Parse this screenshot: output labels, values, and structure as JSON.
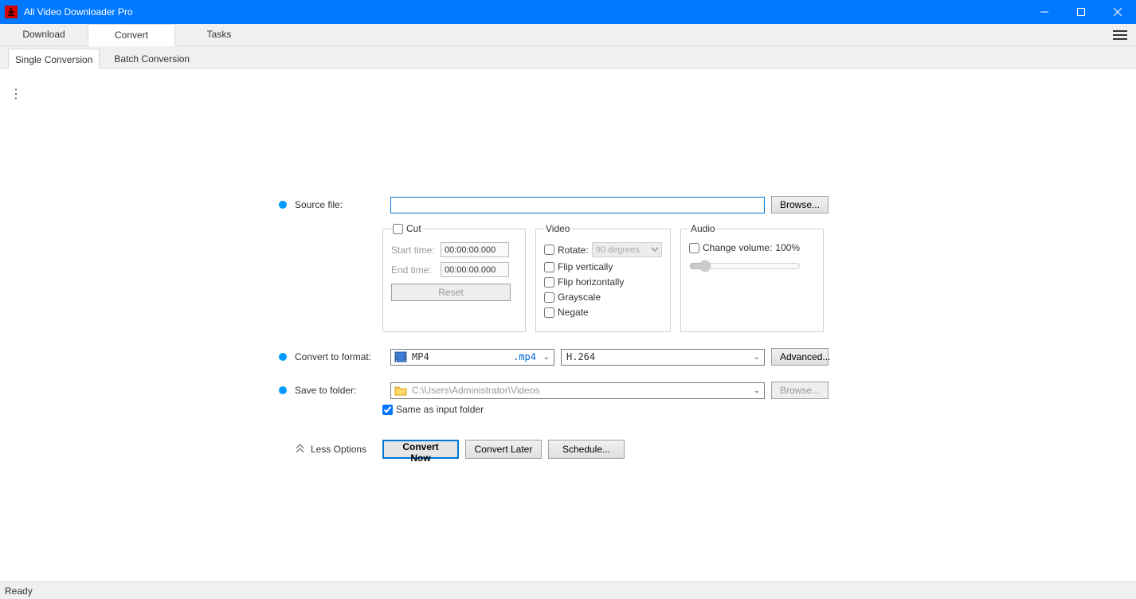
{
  "window": {
    "title": "All Video Downloader Pro"
  },
  "main_tabs": [
    "Download",
    "Convert",
    "Tasks"
  ],
  "main_tab_active": 1,
  "sub_tabs": [
    "Single Conversion",
    "Batch Conversion"
  ],
  "sub_tab_active": 0,
  "form": {
    "source_label": "Source file:",
    "source_value": "",
    "browse_label": "Browse...",
    "cut": {
      "legend": "Cut",
      "start_label": "Start time:",
      "start_value": "00:00:00.000",
      "end_label": "End time:",
      "end_value": "00:00:00.000",
      "reset_label": "Reset"
    },
    "video": {
      "legend": "Video",
      "rotate_label": "Rotate:",
      "rotate_option": "90 degrees",
      "flip_v": "Flip vertically",
      "flip_h": "Flip horizontally",
      "grayscale": "Grayscale",
      "negate": "Negate"
    },
    "audio": {
      "legend": "Audio",
      "volume_label": "Change volume:",
      "volume_value": "100%"
    },
    "convert_to_label": "Convert to format:",
    "format_name": "MP4",
    "format_ext": ".mp4",
    "codec": "H.264",
    "advanced_label": "Advanced...",
    "save_to_label": "Save to folder:",
    "save_path": "C:\\Users\\Administrator\\Videos",
    "same_folder_label": "Same as input folder",
    "less_options_label": "Less Options",
    "convert_now": "Convert Now",
    "convert_later": "Convert Later",
    "schedule": "Schedule..."
  },
  "status": "Ready"
}
